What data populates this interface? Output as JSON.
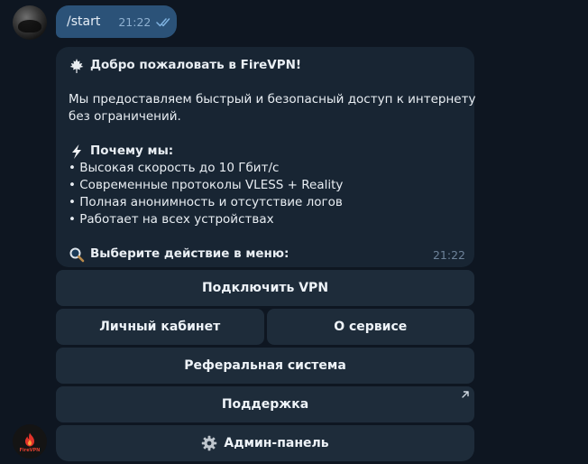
{
  "outgoing": {
    "text": "/start",
    "time": "21:22",
    "status_icon": "double-check-icon"
  },
  "incoming": {
    "welcome_title": "Добро пожаловать в FireVPN!",
    "intro_line1": "Мы предоставляем быстрый и безопасный доступ к интернету",
    "intro_line2": "без ограничений.",
    "why_title": "Почему мы:",
    "features": [
      "• Высокая скорость до 10 Гбит/с",
      "• Современные протоколы VLESS + Reality",
      "• Полная анонимность и отсутствие логов",
      "• Работает на всех устройствах"
    ],
    "choose_prompt": "Выберите действие в меню:",
    "time": "21:22"
  },
  "bot_avatar": {
    "brand": "FireVPN"
  },
  "keyboard": {
    "connect": "Подключить VPN",
    "account": "Личный кабинет",
    "about": "О сервисе",
    "referral": "Реферальная система",
    "support": "Поддержка",
    "admin": "Админ-панель"
  },
  "colors": {
    "background": "#0e1621",
    "outgoing_bubble": "#2b5278",
    "incoming_bubble": "#182533",
    "keyboard_button": "#1e2c3a"
  }
}
